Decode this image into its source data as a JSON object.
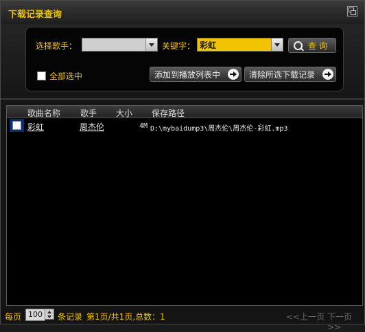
{
  "window": {
    "title": "下载记录查询"
  },
  "search": {
    "singer_label": "选择歌手：",
    "singer_value": "",
    "keyword_label": "关键字：",
    "keyword_value": "彩虹",
    "search_button": "查 询",
    "select_all_label": "全部选中",
    "add_to_playlist_button": "添加到播放列表中",
    "clear_selected_button": "清除所选下载记录"
  },
  "table": {
    "columns": [
      "歌曲名称",
      "歌手",
      "大小",
      "保存路径"
    ],
    "rows": [
      {
        "song": "彩虹",
        "singer": "周杰伦",
        "size": "4M",
        "path": "D:\\mybaidump3\\周杰伦\\周杰伦-彩虹.mp3"
      }
    ]
  },
  "footer": {
    "per_page_label": "每页",
    "page_size": "100",
    "records_label": "条记录",
    "page_info": "第1页/共1页,总数：1",
    "prev_page": "<<上一页",
    "next_page": "下一页>>"
  },
  "colors": {
    "accent": "#f3c500",
    "selection": "#0b2a7a"
  }
}
